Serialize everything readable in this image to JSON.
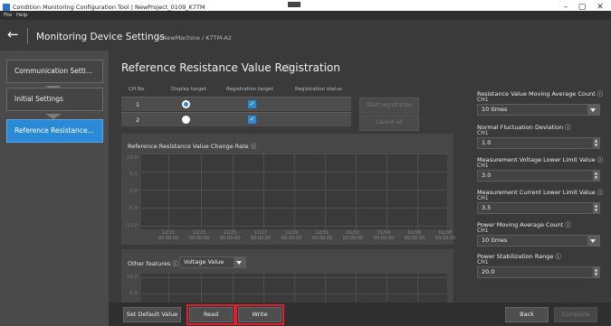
{
  "window": {
    "title": "Condition Monitoring Configuration Tool | NewProject_0109_K7TM",
    "controls": [
      "–",
      "▢",
      "✕"
    ]
  },
  "menu": [
    "File",
    "Help"
  ],
  "header": {
    "back_icon": "←",
    "title": "Monitoring Device Settings",
    "breadcrumb": "> NewMachine / K7TM-A2"
  },
  "sidebar": {
    "items": [
      {
        "label": "Communication Setti...",
        "active": false
      },
      {
        "label": "Initial Settings",
        "active": false
      },
      {
        "label": "Reference Resistance...",
        "active": true
      }
    ]
  },
  "page": {
    "title": "Reference Resistance Value Registration",
    "info_icon": "ⓘ"
  },
  "table": {
    "headers": [
      "CH No.",
      "Display target",
      "Registration target",
      "Registration status"
    ],
    "rows": [
      {
        "ch": "1",
        "display_selected": true,
        "registered": true,
        "status": ""
      },
      {
        "ch": "2",
        "display_selected": false,
        "registered": true,
        "status": ""
      }
    ],
    "start_label": "Start registration",
    "cancel_label": "Cancel all"
  },
  "chart1": {
    "title": "Reference Resistance Value Change Rate ⓘ",
    "y_ticks": [
      "10.0",
      "5.0",
      "0.0",
      "-5.0",
      "-10.0"
    ],
    "x_ticks": [
      {
        "date": "12/21",
        "time": "00:00:00"
      },
      {
        "date": "12/23",
        "time": "00:00:00"
      },
      {
        "date": "12/25",
        "time": "00:00:00"
      },
      {
        "date": "12/27",
        "time": "00:00:00"
      },
      {
        "date": "12/29",
        "time": "00:00:00"
      },
      {
        "date": "12/31",
        "time": "00:00:00"
      },
      {
        "date": "01/02",
        "time": "00:00:00"
      },
      {
        "date": "01/04",
        "time": "00:00:00"
      },
      {
        "date": "01/06",
        "time": "00:00:00"
      },
      {
        "date": "01/08",
        "time": "00:00:00"
      }
    ]
  },
  "chart2": {
    "label": "Other features ⓘ",
    "selected": "Voltage Value",
    "y_ticks": [
      "10.0",
      "5.0"
    ]
  },
  "right_panel": {
    "fields": [
      {
        "label": "Resistance Value Moving Average Count ⓘ",
        "ch": "CH1",
        "value": "10 times",
        "kind": "dropdown"
      },
      {
        "label": "Normal Fluctuation Deviation ⓘ",
        "ch": "CH1",
        "value": "1.0",
        "kind": "spin"
      },
      {
        "label": "Measurement Voltage Lower Limit Value ⓘ",
        "ch": "CH1",
        "value": "3.0",
        "kind": "spin"
      },
      {
        "label": "Measurement Current Lower Limit Value ⓘ",
        "ch": "CH1",
        "value": "3.5",
        "kind": "spin"
      },
      {
        "label": "Power Moving Average Count ⓘ",
        "ch": "CH1",
        "value": "10 times",
        "kind": "dropdown"
      },
      {
        "label": "Power Stabilization Range ⓘ",
        "ch": "CH1",
        "value": "20.0",
        "kind": "spin"
      }
    ]
  },
  "footer": {
    "set_default": "Set Default Value",
    "read": "Read",
    "write": "Write",
    "back": "Back",
    "complete": "Complete"
  },
  "colors": {
    "accent": "#2b8ad8",
    "highlight": "#e0202a"
  }
}
